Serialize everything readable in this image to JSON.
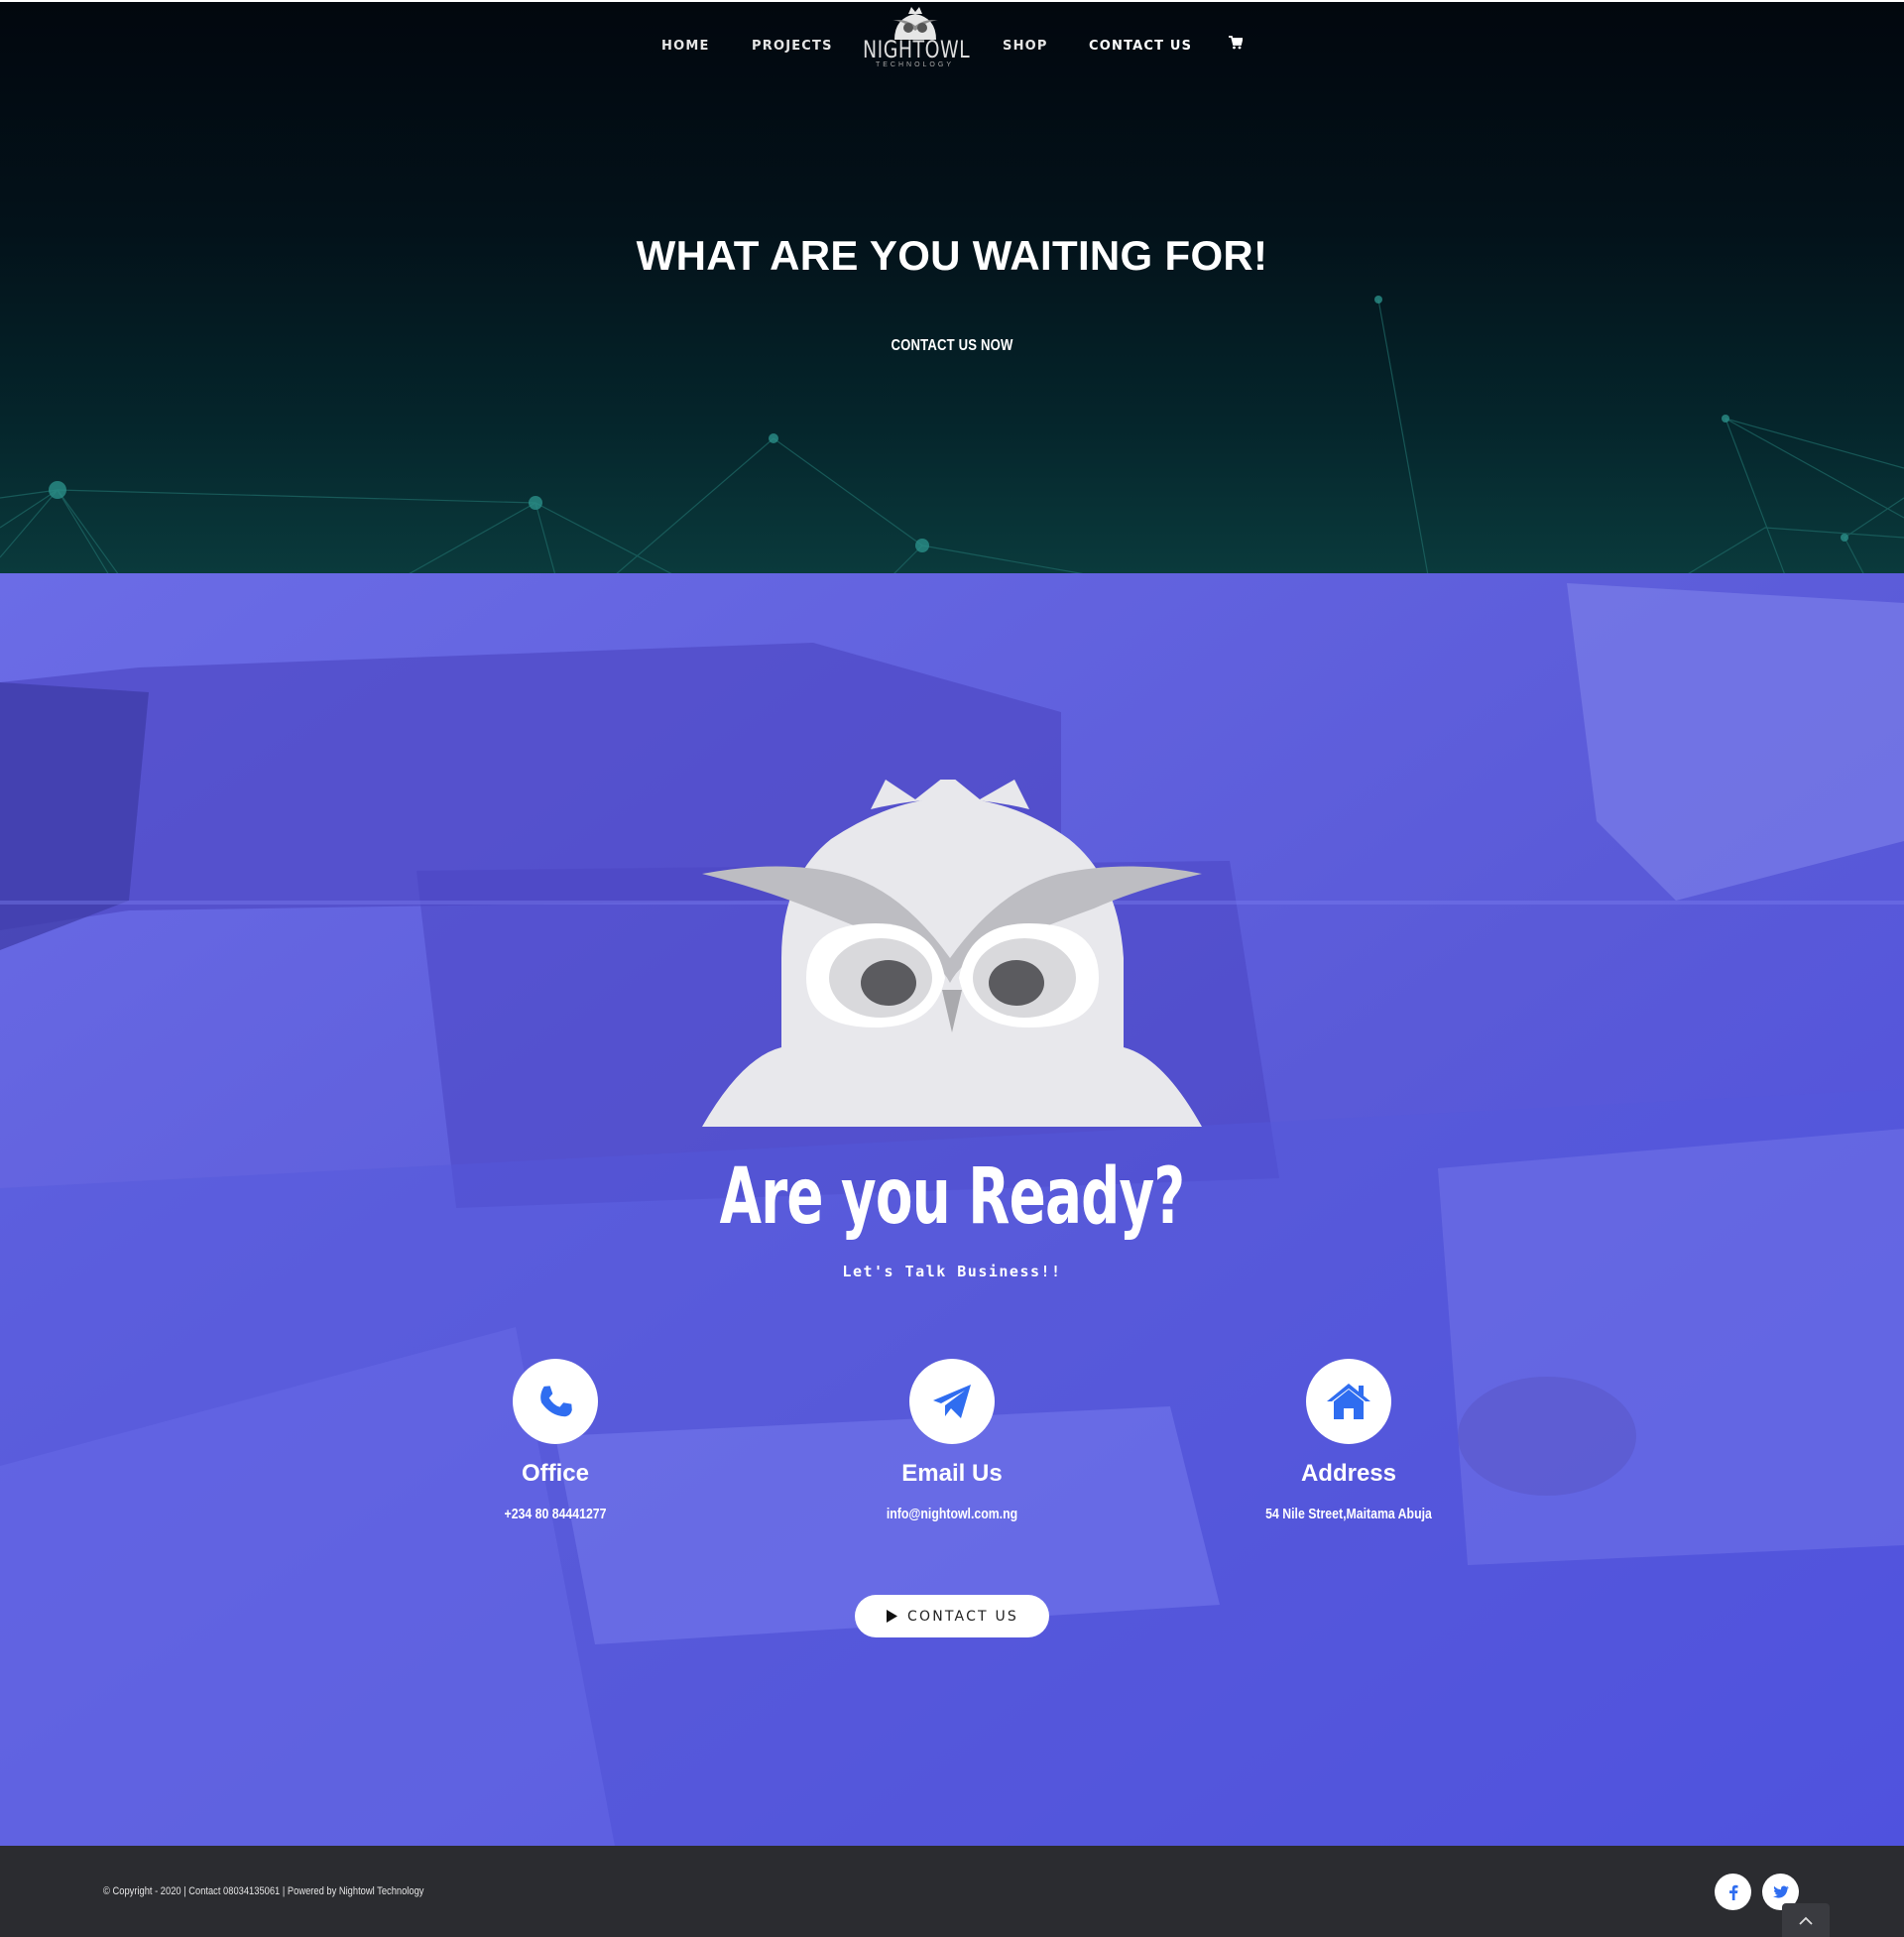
{
  "nav": {
    "items": [
      {
        "label": "HOME"
      },
      {
        "label": "PROJECTS"
      },
      {
        "label": "SHOP"
      },
      {
        "label": "CONTACT US"
      }
    ],
    "cart_icon": "shopping-cart-icon",
    "logo": {
      "word": "NIGHTOWL",
      "sub": "TECHNOLOGY"
    }
  },
  "hero": {
    "title": "WHAT ARE YOU WAITING FOR!",
    "cta": "CONTACT US NOW"
  },
  "ready": {
    "title": "Are you Ready?",
    "subtitle": "Let's Talk Business!!",
    "cards": [
      {
        "heading": "Office",
        "value": "+234 80 84441277",
        "icon": "phone-icon"
      },
      {
        "heading": "Email Us",
        "value": "info@nightowl.com.ng",
        "icon": "paper-plane-icon"
      },
      {
        "heading": "Address",
        "value": "54 Nile Street,Maitama Abuja",
        "icon": "home-icon"
      }
    ],
    "button": {
      "label": "CONTACT US",
      "icon": "play-icon"
    }
  },
  "footer": {
    "copyright": "© Copyright - 2020 | Contact 08034135061 | Powered by Nightowl Technology",
    "social": [
      "facebook-icon",
      "twitter-icon"
    ],
    "to_top_icon": "chevron-up-icon"
  },
  "colors": {
    "hero_bg": "#02070e",
    "ready_bg": "#5d5ee6",
    "accent_blue": "#2f6df0",
    "footer_bg": "#2b2c30"
  }
}
